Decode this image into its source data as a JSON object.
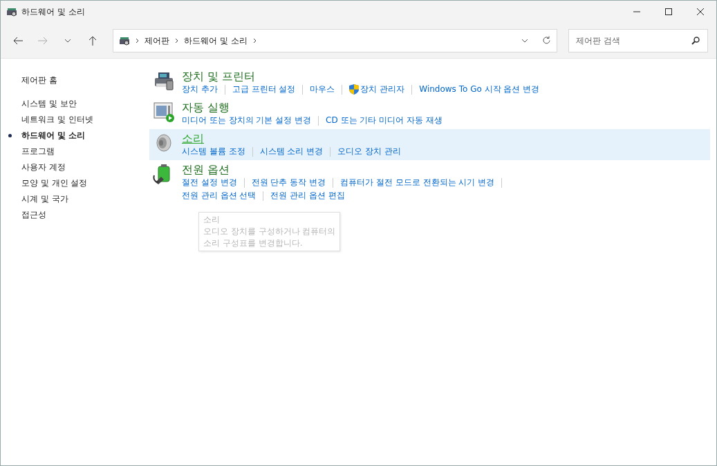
{
  "window": {
    "title": "하드웨어 및 소리"
  },
  "breadcrumb": [
    "제어판",
    "하드웨어 및 소리"
  ],
  "search": {
    "placeholder": "제어판 검색"
  },
  "sidebar": {
    "home": "제어판 홈",
    "items": [
      {
        "label": "시스템 및 보안",
        "selected": false
      },
      {
        "label": "네트워크 및 인터넷",
        "selected": false
      },
      {
        "label": "하드웨어 및 소리",
        "selected": true
      },
      {
        "label": "프로그램",
        "selected": false
      },
      {
        "label": "사용자 계정",
        "selected": false
      },
      {
        "label": "모양 및 개인 설정",
        "selected": false
      },
      {
        "label": "시계 및 국가",
        "selected": false
      },
      {
        "label": "접근성",
        "selected": false
      }
    ]
  },
  "categories": [
    {
      "kind": "printer",
      "title": "장치 및 프린터",
      "hovered": false,
      "links": [
        {
          "label": "장치 추가",
          "shield": false
        },
        {
          "label": "고급 프린터 설정",
          "shield": false
        },
        {
          "label": "마우스",
          "shield": false
        },
        {
          "label": "장치 관리자",
          "shield": true
        },
        {
          "label": "Windows To Go 시작 옵션 변경",
          "shield": false
        }
      ]
    },
    {
      "kind": "autoplay",
      "title": "자동 실행",
      "hovered": false,
      "links": [
        {
          "label": "미디어 또는 장치의 기본 설정 변경",
          "shield": false
        },
        {
          "label": "CD 또는 기타 미디어 자동 재생",
          "shield": false
        }
      ]
    },
    {
      "kind": "speaker",
      "title": "소리",
      "hovered": true,
      "links": [
        {
          "label": "시스템 볼륨 조정",
          "shield": false
        },
        {
          "label": "시스템 소리 변경",
          "shield": false
        },
        {
          "label": "오디오 장치 관리",
          "shield": false
        }
      ]
    },
    {
      "kind": "battery",
      "title": "전원 옵션",
      "hovered": false,
      "links": [
        {
          "label": "절전 설정 변경",
          "shield": false
        },
        {
          "label": "전원 단추 동작 변경",
          "shield": false
        },
        {
          "label": "컴퓨터가 절전 모드로 전환되는 시기 변경",
          "shield": false
        },
        {
          "label": "전원 관리 옵션 선택",
          "shield": false
        },
        {
          "label": "전원 관리 옵션 편집",
          "shield": false
        }
      ]
    }
  ],
  "tooltip": {
    "title": "소리",
    "lines": [
      "오디오 장치를 구성하거나 컴퓨터의",
      "소리 구성표를 변경합니다."
    ]
  }
}
